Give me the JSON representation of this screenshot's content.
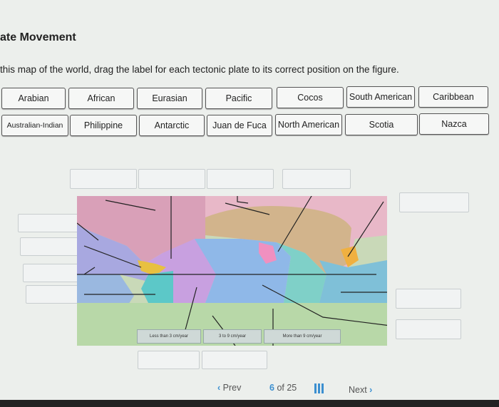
{
  "header": {
    "title": "ate Movement",
    "instruction": "this map of the world, drag the label for each tectonic plate to its correct position on the figure."
  },
  "labels": [
    "Arabian",
    "African",
    "Eurasian",
    "Pacific",
    "Cocos",
    "South American",
    "Caribbean",
    "Australian-Indian",
    "Philippine",
    "Antarctic",
    "Juan de Fuca",
    "North American",
    "Scotia",
    "Nazca"
  ],
  "legend": [
    "Less than 3 cm/year",
    "3 to 9 cm/year",
    "More than 9 cm/year"
  ],
  "pagination": {
    "prev": "Prev",
    "current": "6",
    "of": "of",
    "total": "25",
    "next": "Next"
  },
  "colors": {
    "accent": "#3b8fd0"
  }
}
